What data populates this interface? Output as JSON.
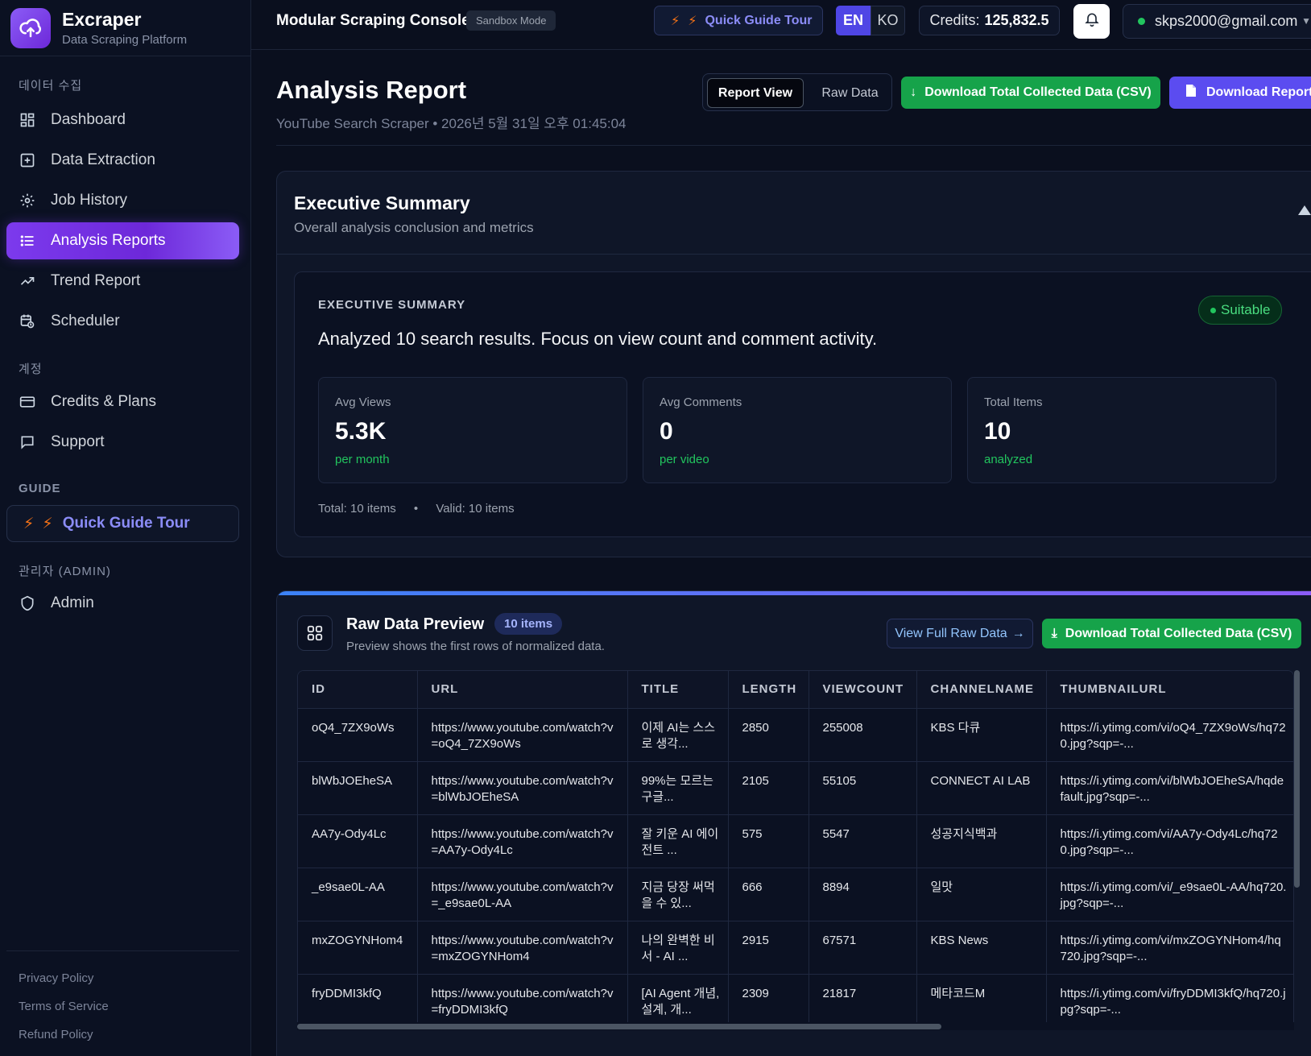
{
  "brand": {
    "name": "Excraper",
    "subtitle": "Data Scraping Platform",
    "logo_icon": "cloud-upload-icon"
  },
  "sidebar": {
    "sections": {
      "data": "데이터 수집",
      "account": "계정",
      "guide": "GUIDE",
      "admin": "관리자 (ADMIN)"
    },
    "items": [
      {
        "label": "Dashboard",
        "icon": "dashboard-icon"
      },
      {
        "label": "Data Extraction",
        "icon": "plus-square-icon"
      },
      {
        "label": "Job History",
        "icon": "gear-icon"
      },
      {
        "label": "Analysis Reports",
        "icon": "list-icon",
        "active": true
      },
      {
        "label": "Trend Report",
        "icon": "trend-icon"
      },
      {
        "label": "Scheduler",
        "icon": "calendar-clock-icon"
      },
      {
        "label": "Credits & Plans",
        "icon": "card-icon"
      },
      {
        "label": "Support",
        "icon": "chat-icon"
      },
      {
        "label": "Admin",
        "icon": "shield-icon"
      }
    ],
    "guide_button": "Quick Guide Tour",
    "footer_links": [
      "Privacy Policy",
      "Terms of Service",
      "Refund Policy"
    ]
  },
  "header": {
    "title": "Modular Scraping Console",
    "mode_badge": "Sandbox Mode",
    "tour_button": "Quick Guide Tour",
    "lang_en": "EN",
    "lang_ko": "KO",
    "credits_label": "Credits:",
    "credits_value": "125,832.5",
    "user_email": "skps2000@gmail.com"
  },
  "page": {
    "title": "Analysis Report",
    "subtitle": "YouTube Search Scraper • 2026년 5월 31일 오후 01:45:04",
    "view_report": "Report View",
    "view_raw": "Raw Data",
    "download_csv": "Download Total Collected Data (CSV)",
    "download_report": "Download Report"
  },
  "executive": {
    "title": "Executive Summary",
    "subtitle": "Overall analysis conclusion and metrics",
    "label": "EXECUTIVE SUMMARY",
    "badge": "Suitable",
    "summary": "Analyzed 10 search results. Focus on view count and comment activity.",
    "metrics": [
      {
        "label": "Avg Views",
        "value": "5.3K",
        "unit": "per month"
      },
      {
        "label": "Avg Comments",
        "value": "0",
        "unit": "per video"
      },
      {
        "label": "Total Items",
        "value": "10",
        "unit": "analyzed"
      }
    ],
    "total": "Total: 10 items",
    "valid": "Valid: 10 items"
  },
  "raw": {
    "title": "Raw Data Preview",
    "count": "10 items",
    "subtitle": "Preview shows the first rows of normalized data.",
    "view_full": "View Full Raw Data",
    "download_csv": "Download Total Collected Data (CSV)",
    "columns": [
      "ID",
      "URL",
      "TITLE",
      "LENGTH",
      "VIEWCOUNT",
      "CHANNELNAME",
      "THUMBNAILURL"
    ],
    "rows": [
      [
        "oQ4_7ZX9oWs",
        "https://www.youtube.com/watch?v=oQ4_7ZX9oWs",
        "이제 AI는 스스로 생각...",
        "2850",
        "255008",
        "KBS 다큐",
        "https://i.ytimg.com/vi/oQ4_7ZX9oWs/hq720.jpg?sqp=-..."
      ],
      [
        "blWbJOEheSA",
        "https://www.youtube.com/watch?v=blWbJOEheSA",
        "99%는 모르는 구글...",
        "2105",
        "55105",
        "CONNECT AI LAB",
        "https://i.ytimg.com/vi/blWbJOEheSA/hqdefault.jpg?sqp=-..."
      ],
      [
        "AA7y-Ody4Lc",
        "https://www.youtube.com/watch?v=AA7y-Ody4Lc",
        "잘 키운 AI 에이전트 ...",
        "575",
        "5547",
        "성공지식백과",
        "https://i.ytimg.com/vi/AA7y-Ody4Lc/hq720.jpg?sqp=-..."
      ],
      [
        "_e9sae0L-AA",
        "https://www.youtube.com/watch?v=_e9sae0L-AA",
        "지금 당장 써먹을 수 있...",
        "666",
        "8894",
        "일맛",
        "https://i.ytimg.com/vi/_e9sae0L-AA/hq720.jpg?sqp=-..."
      ],
      [
        "mxZOGYNHom4",
        "https://www.youtube.com/watch?v=mxZOGYNHom4",
        "나의 완벽한 비서 - AI ...",
        "2915",
        "67571",
        "KBS News",
        "https://i.ytimg.com/vi/mxZOGYNHom4/hq720.jpg?sqp=-..."
      ],
      [
        "fryDDMI3kfQ",
        "https://www.youtube.com/watch?v=fryDDMI3kfQ",
        "[AI Agent 개념, 설계, 개...",
        "2309",
        "21817",
        "메타코드M",
        "https://i.ytimg.com/vi/fryDDMI3kfQ/hq720.jpg?sqp=-..."
      ]
    ]
  },
  "colors": {
    "accent": "#7c3aed",
    "success": "#16a34a",
    "primary": "#5b4cf0"
  }
}
